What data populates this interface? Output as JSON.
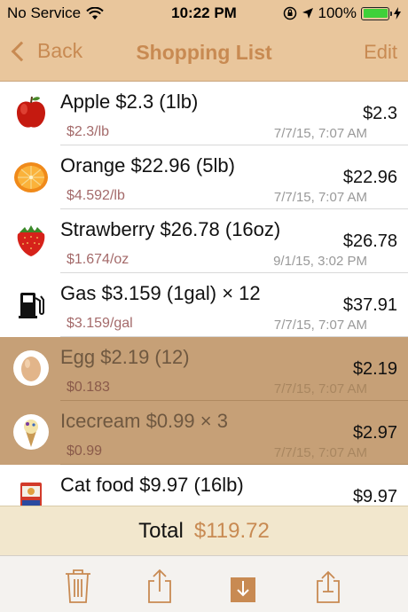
{
  "status": {
    "carrier": "No Service",
    "time": "10:22 PM",
    "battery": "100%",
    "battery_level": 1.0,
    "icons": [
      "wifi-icon",
      "rotation-lock-icon",
      "location-icon",
      "battery-icon",
      "charging-icon"
    ]
  },
  "nav": {
    "back_label": "Back",
    "title": "Shopping List",
    "edit_label": "Edit"
  },
  "items": [
    {
      "title": "Apple  $2.3 (1lb)",
      "unit": "$2.3/lb",
      "date": "7/7/15, 7:07 AM",
      "total": "$2.3",
      "checked": false,
      "icon": "apple-icon"
    },
    {
      "title": "Orange  $22.96 (5lb)",
      "unit": "$4.592/lb",
      "date": "7/7/15, 7:07 AM",
      "total": "$22.96",
      "checked": false,
      "icon": "orange-icon"
    },
    {
      "title": "Strawberry  $26.78 (16oz)",
      "unit": "$1.674/oz",
      "date": "9/1/15, 3:02 PM",
      "total": "$26.78",
      "checked": false,
      "icon": "strawberry-icon"
    },
    {
      "title": "Gas  $3.159 (1gal) × 12",
      "unit": "$3.159/gal",
      "date": "7/7/15, 7:07 AM",
      "total": "$37.91",
      "checked": false,
      "icon": "gas-pump-icon"
    },
    {
      "title": "Egg  $2.19 (12)",
      "unit": "$0.183",
      "date": "7/7/15, 7:07 AM",
      "total": "$2.19",
      "checked": true,
      "icon": "egg-icon"
    },
    {
      "title": "Icecream  $0.99 × 3",
      "unit": "$0.99",
      "date": "7/7/15, 7:07 AM",
      "total": "$2.97",
      "checked": true,
      "icon": "icecream-icon"
    },
    {
      "title": "Cat food  $9.97 (16lb)",
      "unit": "",
      "date": "",
      "total": "$9.97",
      "checked": false,
      "icon": "cat-food-icon"
    }
  ],
  "total": {
    "label": "Total",
    "value": "$119.72"
  },
  "toolbar": {
    "icons": [
      "trash-icon",
      "share-icon",
      "download-icon",
      "export-icon"
    ],
    "accent": "#c88a52"
  },
  "colors": {
    "nav_background": "#e9c69c",
    "accent": "#c88a52",
    "checked_row": "#c6a077",
    "total_bar": "#f2e7cd"
  }
}
